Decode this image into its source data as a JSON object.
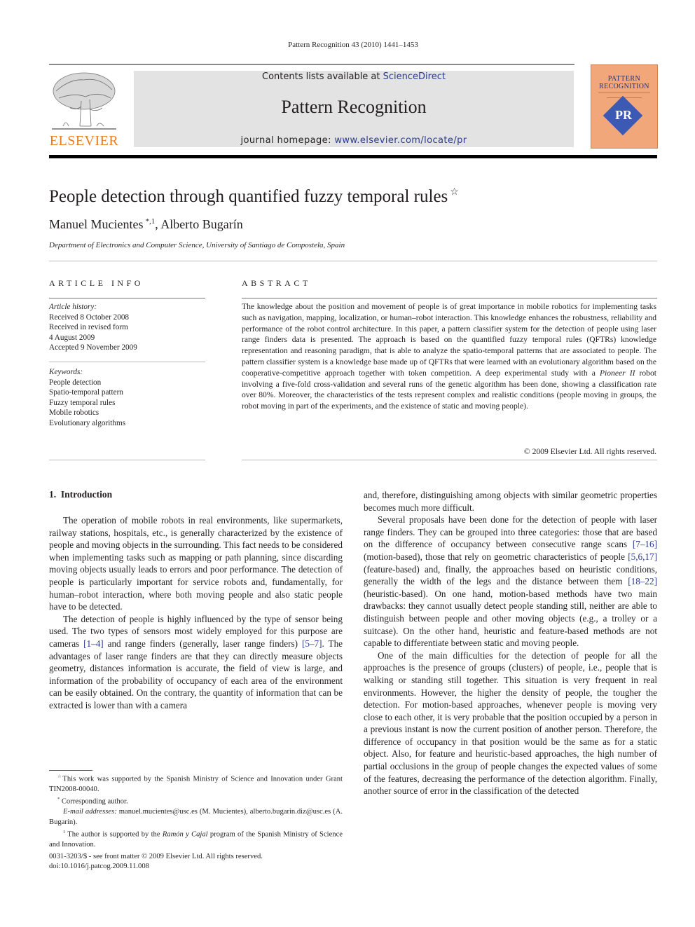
{
  "header": {
    "running_head": "Pattern Recognition 43 (2010) 1441–1453",
    "publisher_logo_text": "ELSEVIER",
    "contents_prefix": "Contents lists available at ",
    "contents_link": "ScienceDirect",
    "journal_title": "Pattern Recognition",
    "homepage_prefix": "journal homepage: ",
    "homepage_link": "www.elsevier.com/locate/pr",
    "cover": {
      "line1": "PATTERN",
      "line2": "RECOGNITION",
      "emblem": "PR"
    },
    "colors": {
      "elsevier_orange": "#e87d1e",
      "link_blue": "#2a3a8e",
      "banner_gray": "#e3e3e3",
      "cover_orange": "#f2a77a",
      "cover_emblem_blue": "#3c5ab4"
    }
  },
  "article": {
    "title": "People detection through quantified fuzzy temporal rules",
    "title_note_mark": "☆",
    "authors": [
      {
        "name": "Manuel Mucientes",
        "marks": "*,1"
      },
      {
        "name": "Alberto Bugarín",
        "marks": ""
      }
    ],
    "author_separator": ", ",
    "affiliation": "Department of Electronics and Computer Science, University of Santiago de Compostela, Spain"
  },
  "article_info": {
    "heading": "ARTICLE INFO",
    "history_label": "Article history:",
    "history": [
      "Received 8 October 2008",
      "Received in revised form",
      "4 August 2009",
      "Accepted 9 November 2009"
    ],
    "keywords_label": "Keywords:",
    "keywords": [
      "People detection",
      "Spatio-temporal pattern",
      "Fuzzy temporal rules",
      "Mobile robotics",
      "Evolutionary algorithms"
    ]
  },
  "abstract": {
    "heading": "ABSTRACT",
    "text_before_italic": "The knowledge about the position and movement of people is of great importance in mobile robotics for implementing tasks such as navigation, mapping, localization, or human–robot interaction. This knowledge enhances the robustness, reliability and performance of the robot control architecture. In this paper, a pattern classifier system for the detection of people using laser range finders data is presented. The approach is based on the quantified fuzzy temporal rules (QFTRs) knowledge representation and reasoning paradigm, that is able to analyze the spatio-temporal patterns that are associated to people. The pattern classifier system is a knowledge base made up of QFTRs that were learned with an evolutionary algorithm based on the cooperative-competitive approach together with token competition. A deep experimental study with a ",
    "italic": "Pioneer II",
    "text_after_italic": " robot involving a five-fold cross-validation and several runs of the genetic algorithm has been done, showing a classification rate over 80%. Moreover, the characteristics of the tests represent complex and realistic conditions (people moving in groups, the robot moving in part of the experiments, and the existence of static and moving people).",
    "copyright": "© 2009 Elsevier Ltd. All rights reserved."
  },
  "introduction": {
    "heading": "1.  Introduction",
    "left_column": {
      "p1": "The operation of mobile robots in real environments, like supermarkets, railway stations, hospitals, etc., is generally characterized by the existence of people and moving objects in the surrounding. This fact needs to be considered when implementing tasks such as mapping or path planning, since discarding moving objects usually leads to errors and poor performance. The detection of people is particularly important for service robots and, fundamentally, for human–robot interaction, where both moving people and also static people have to be detected.",
      "p2_a": "The detection of people is highly influenced by the type of sensor being used. The two types of sensors most widely employed for this purpose are cameras ",
      "p2_ref1": "[1–4]",
      "p2_b": " and range finders (generally, laser range finders) ",
      "p2_ref2": "[5–7]",
      "p2_c": ". The advantages of laser range finders are that they can directly measure objects geometry, distances information is accurate, the field of view is large, and information of the probability of occupancy of each area of the environment can be easily obtained. On the contrary, the quantity of information that can be extracted is lower than with a camera"
    },
    "right_column": {
      "p0": "and, therefore, distinguishing among objects with similar geometric properties becomes much more difficult.",
      "p1_a": "Several proposals have been done for the detection of people with laser range finders. They can be grouped into three categories: those that are based on the difference of occupancy between consecutive range scans ",
      "p1_ref1": "[7–16]",
      "p1_b": " (motion-based), those that rely on geometric characteristics of people ",
      "p1_ref2": "[5,6,17]",
      "p1_c": " (feature-based) and, finally, the approaches based on heuristic conditions, generally the width of the legs and the distance between them ",
      "p1_ref3": "[18–22]",
      "p1_d": " (heuristic-based). On one hand, motion-based methods have two main drawbacks: they cannot usually detect people standing still, neither are able to distinguish between people and other moving objects (e.g., a trolley or a suitcase). On the other hand, heuristic and feature-based methods are not capable to differentiate between static and moving people.",
      "p2": "One of the main difficulties for the detection of people for all the approaches is the presence of groups (clusters) of people, i.e., people that is walking or standing still together. This situation is very frequent in real environments. However, the higher the density of people, the tougher the detection. For motion-based approaches, whenever people is moving very close to each other, it is very probable that the position occupied by a person in a previous instant is now the current position of another person. Therefore, the difference of occupancy in that position would be the same as for a static object. Also, for feature and heuristic-based approaches, the high number of partial occlusions in the group of people changes the expected values of some of the features, decreasing the performance of the detection algorithm. Finally, another source of error in the classification of the detected"
    }
  },
  "footnotes": {
    "star_mark": "☆",
    "star_text": "This work was supported by the Spanish Ministry of Science and Innovation under Grant TIN2008-00040.",
    "corr_mark": "*",
    "corr_text": "Corresponding author.",
    "email_label": "E-mail addresses:",
    "email_text": " manuel.mucientes@usc.es (M. Mucientes), alberto.bugarin.diz@usc.es (A. Bugarín).",
    "one_mark": "1",
    "one_a": " The author is supported by the ",
    "one_italic": "Ramón y Cajal",
    "one_b": " program of the Spanish Ministry of Science and Innovation."
  },
  "front_matter": {
    "issn_line": "0031-3203/$ - see front matter © 2009 Elsevier Ltd. All rights reserved.",
    "doi": "doi:10.1016/j.patcog.2009.11.008"
  }
}
